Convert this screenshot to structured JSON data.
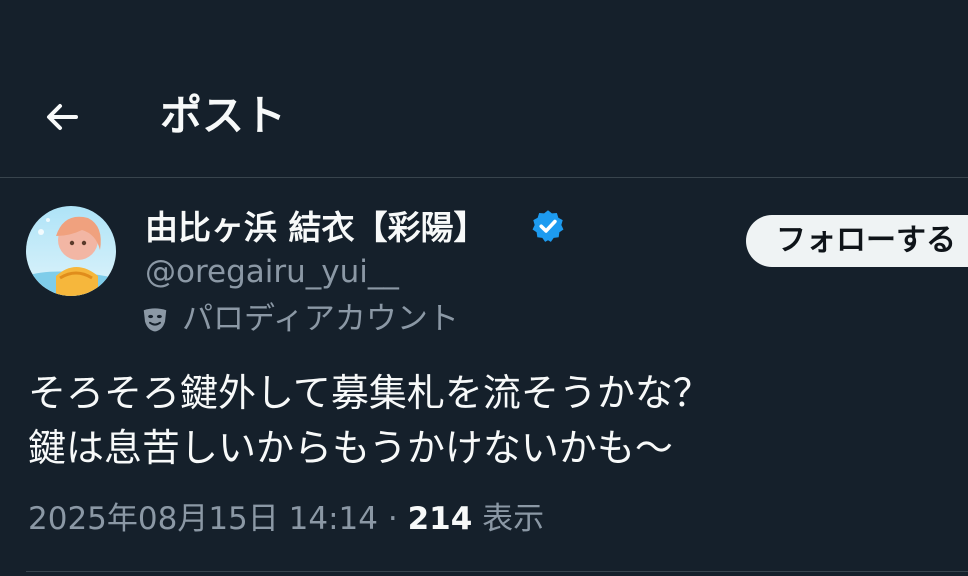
{
  "header": {
    "title": "ポスト",
    "back_icon": "arrow-left-icon"
  },
  "author": {
    "display_name": "由比ヶ浜 結衣【彩陽】",
    "verified_icon": "verified-badge-icon",
    "handle": "@oregairu_yui__",
    "account_type_icon": "theater-mask-icon",
    "account_type_label": "パロディアカウント"
  },
  "follow_button": {
    "label": "フォローする"
  },
  "post": {
    "lines": [
      "そろそろ鍵外して募集札を流そうかな？",
      "鍵は息苦しいからもうかけないかも〜"
    ],
    "timestamp": "2025年08月15日 14:14",
    "separator": "·",
    "views_count": "214",
    "views_label": "表示"
  },
  "colors": {
    "background": "#15202b",
    "text_primary": "#f7f9f9",
    "text_secondary": "#8b98a5",
    "verified_blue": "#1d9bf0",
    "divider": "#38444d",
    "follow_bg": "#eff3f4"
  }
}
